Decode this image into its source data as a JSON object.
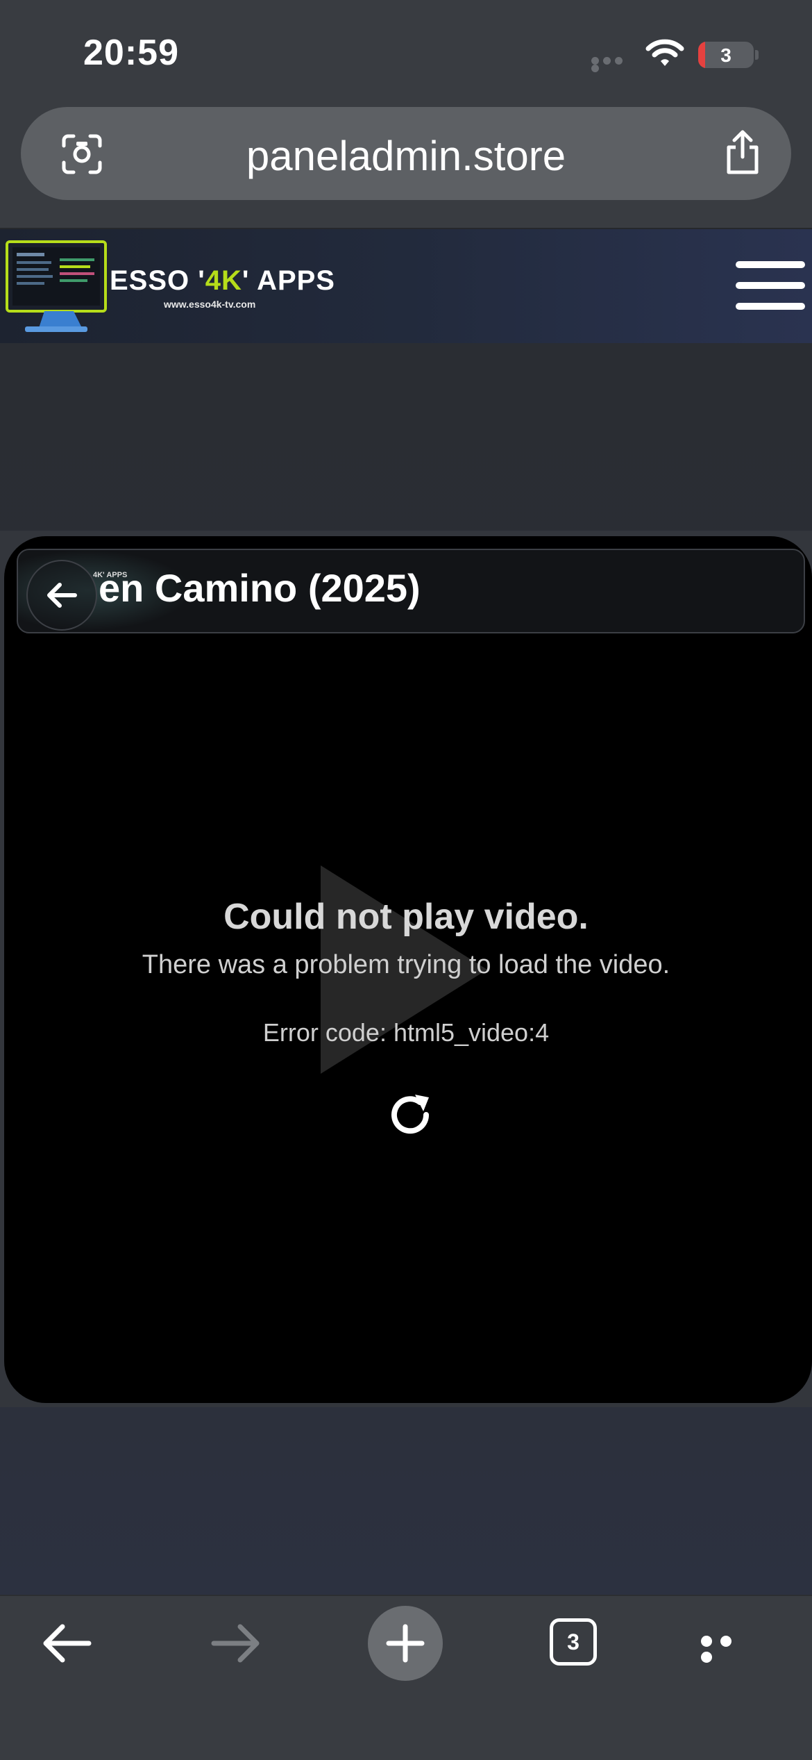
{
  "status_bar": {
    "time": "20:59",
    "battery_level": "3",
    "icons": [
      "signal-dots-icon",
      "wifi-icon",
      "battery-icon"
    ]
  },
  "browser": {
    "url": "paneladmin.store",
    "tab_count": "3"
  },
  "site": {
    "logo_prefix": "ESSO '",
    "logo_accent": "4K",
    "logo_suffix": "' APPS",
    "logo_url": "www.esso4k-tv.com",
    "accent_color": "#b6dd1a"
  },
  "player": {
    "mini_logo": "4K' APPS",
    "title": "en Camino (2025)",
    "error_title": "Could not play video.",
    "error_message": "There was a problem trying to load the video.",
    "error_code": "Error code: html5_video:4"
  },
  "toolbar": {
    "icons": [
      "back-arrow-icon",
      "forward-arrow-icon",
      "plus-icon",
      "tabs-icon",
      "more-icon"
    ]
  }
}
